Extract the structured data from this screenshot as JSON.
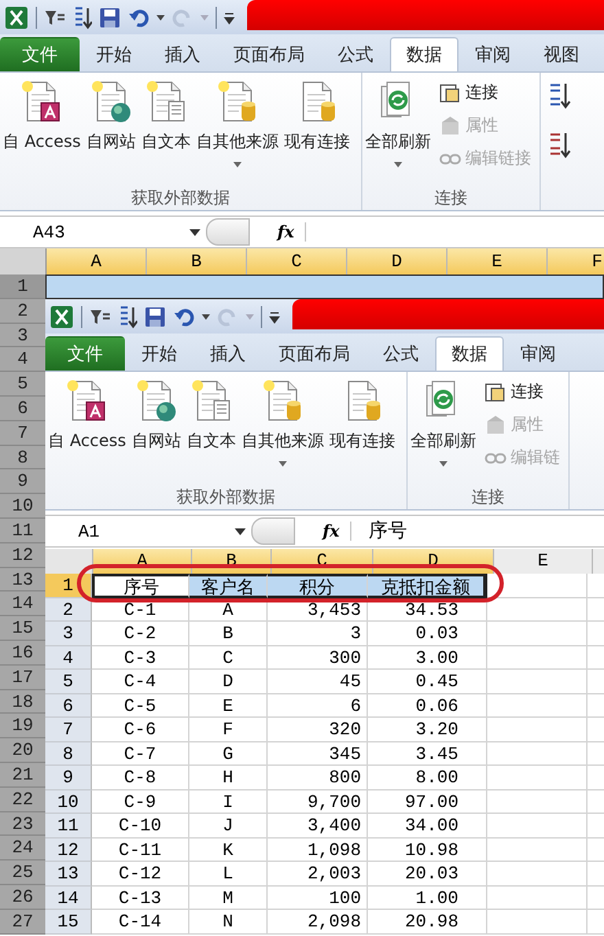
{
  "outer": {
    "tabs": [
      {
        "label": "文件",
        "kind": "file",
        "selected": false
      },
      {
        "label": "开始",
        "kind": "tab",
        "selected": false
      },
      {
        "label": "插入",
        "kind": "tab",
        "selected": false
      },
      {
        "label": "页面布局",
        "kind": "tab",
        "selected": false
      },
      {
        "label": "公式",
        "kind": "tab",
        "selected": false
      },
      {
        "label": "数据",
        "kind": "tab",
        "selected": true
      },
      {
        "label": "审阅",
        "kind": "tab",
        "selected": false
      },
      {
        "label": "视图",
        "kind": "tab",
        "selected": false
      }
    ],
    "groups": [
      {
        "label": "获取外部数据",
        "buttons": [
          {
            "label": "自 Access",
            "kind": "large",
            "dropdown": false
          },
          {
            "label": "自网站",
            "kind": "large",
            "dropdown": false
          },
          {
            "label": "自文本",
            "kind": "large",
            "dropdown": false
          },
          {
            "label": "自其他来源",
            "kind": "large",
            "dropdown": true
          },
          {
            "label": "现有连接",
            "kind": "large",
            "dropdown": false
          }
        ]
      },
      {
        "label": "连接",
        "buttons": [
          {
            "label": "全部刷新",
            "kind": "large",
            "dropdown": true
          },
          {
            "label": "连接",
            "kind": "small",
            "disabled": false
          },
          {
            "label": "属性",
            "kind": "small",
            "disabled": true
          },
          {
            "label": "编辑链接",
            "kind": "small",
            "disabled": true
          }
        ]
      }
    ],
    "sort_buttons": true,
    "name_box": "A43",
    "fx": "fx",
    "columns": [
      {
        "label": "A",
        "selected": true
      },
      {
        "label": "B",
        "selected": true
      },
      {
        "label": "C",
        "selected": true
      },
      {
        "label": "D",
        "selected": true
      },
      {
        "label": "E",
        "selected": true
      },
      {
        "label": "F",
        "selected": true
      }
    ],
    "rows": [
      {
        "label": "1",
        "selected": true
      },
      {
        "label": "2",
        "selected": false
      },
      {
        "label": "3",
        "selected": false
      },
      {
        "label": "4",
        "selected": false
      },
      {
        "label": "5",
        "selected": false
      },
      {
        "label": "6",
        "selected": false
      },
      {
        "label": "7",
        "selected": false
      },
      {
        "label": "8",
        "selected": false
      },
      {
        "label": "9",
        "selected": false
      },
      {
        "label": "10",
        "selected": false
      },
      {
        "label": "11",
        "selected": false
      },
      {
        "label": "12",
        "selected": false
      },
      {
        "label": "13",
        "selected": false
      },
      {
        "label": "14",
        "selected": false
      },
      {
        "label": "15",
        "selected": false
      },
      {
        "label": "16",
        "selected": false
      },
      {
        "label": "17",
        "selected": false
      },
      {
        "label": "18",
        "selected": false
      },
      {
        "label": "19",
        "selected": false
      },
      {
        "label": "20",
        "selected": false
      },
      {
        "label": "21",
        "selected": false
      },
      {
        "label": "22",
        "selected": false
      },
      {
        "label": "23",
        "selected": false
      },
      {
        "label": "24",
        "selected": false
      },
      {
        "label": "25",
        "selected": false
      },
      {
        "label": "26",
        "selected": false
      },
      {
        "label": "27",
        "selected": false
      }
    ]
  },
  "inner": {
    "tabs": [
      {
        "label": "文件",
        "kind": "file",
        "selected": false
      },
      {
        "label": "开始",
        "kind": "tab",
        "selected": false
      },
      {
        "label": "插入",
        "kind": "tab",
        "selected": false
      },
      {
        "label": "页面布局",
        "kind": "tab",
        "selected": false
      },
      {
        "label": "公式",
        "kind": "tab",
        "selected": false
      },
      {
        "label": "数据",
        "kind": "tab",
        "selected": true
      },
      {
        "label": "审阅",
        "kind": "tab",
        "selected": false
      }
    ],
    "groups": [
      {
        "label": "获取外部数据",
        "buttons": [
          {
            "label": "自 Access",
            "kind": "large",
            "dropdown": false
          },
          {
            "label": "自网站",
            "kind": "large",
            "dropdown": false
          },
          {
            "label": "自文本",
            "kind": "large",
            "dropdown": false
          },
          {
            "label": "自其他来源",
            "kind": "large",
            "dropdown": true
          },
          {
            "label": "现有连接",
            "kind": "large",
            "dropdown": false
          }
        ]
      },
      {
        "label": "连接",
        "buttons": [
          {
            "label": "全部刷新",
            "kind": "large",
            "dropdown": true
          },
          {
            "label": "连接",
            "kind": "small",
            "disabled": false
          },
          {
            "label": "属性",
            "kind": "small",
            "disabled": true
          },
          {
            "label": "编辑链",
            "kind": "small",
            "disabled": true
          }
        ]
      }
    ],
    "name_box": "A1",
    "fx": "fx",
    "formula": "序号",
    "columns": [
      {
        "label": "A",
        "selected": true
      },
      {
        "label": "B",
        "selected": true
      },
      {
        "label": "C",
        "selected": true
      },
      {
        "label": "D",
        "selected": true
      },
      {
        "label": "E",
        "selected": false
      }
    ],
    "rows": [
      {
        "label": "1",
        "selected": true,
        "cells": [
          "序号",
          "客户名",
          "积分",
          "克抵扣金额"
        ]
      },
      {
        "label": "2",
        "selected": false,
        "cells": [
          "C-1",
          "A",
          "3,453",
          "34.53"
        ]
      },
      {
        "label": "3",
        "selected": false,
        "cells": [
          "C-2",
          "B",
          "3",
          "0.03"
        ]
      },
      {
        "label": "4",
        "selected": false,
        "cells": [
          "C-3",
          "C",
          "300",
          "3.00"
        ]
      },
      {
        "label": "5",
        "selected": false,
        "cells": [
          "C-4",
          "D",
          "45",
          "0.45"
        ]
      },
      {
        "label": "6",
        "selected": false,
        "cells": [
          "C-5",
          "E",
          "6",
          "0.06"
        ]
      },
      {
        "label": "7",
        "selected": false,
        "cells": [
          "C-6",
          "F",
          "320",
          "3.20"
        ]
      },
      {
        "label": "8",
        "selected": false,
        "cells": [
          "C-7",
          "G",
          "345",
          "3.45"
        ]
      },
      {
        "label": "9",
        "selected": false,
        "cells": [
          "C-8",
          "H",
          "800",
          "8.00"
        ]
      },
      {
        "label": "10",
        "selected": false,
        "cells": [
          "C-9",
          "I",
          "9,700",
          "97.00"
        ]
      },
      {
        "label": "11",
        "selected": false,
        "cells": [
          "C-10",
          "J",
          "3,400",
          "34.00"
        ]
      },
      {
        "label": "12",
        "selected": false,
        "cells": [
          "C-11",
          "K",
          "1,098",
          "10.98"
        ]
      },
      {
        "label": "13",
        "selected": false,
        "cells": [
          "C-12",
          "L",
          "2,003",
          "20.03"
        ]
      },
      {
        "label": "14",
        "selected": false,
        "cells": [
          "C-13",
          "M",
          "100",
          "1.00"
        ]
      },
      {
        "label": "15",
        "selected": false,
        "cells": [
          "C-14",
          "N",
          "2,098",
          "20.98"
        ]
      }
    ]
  }
}
